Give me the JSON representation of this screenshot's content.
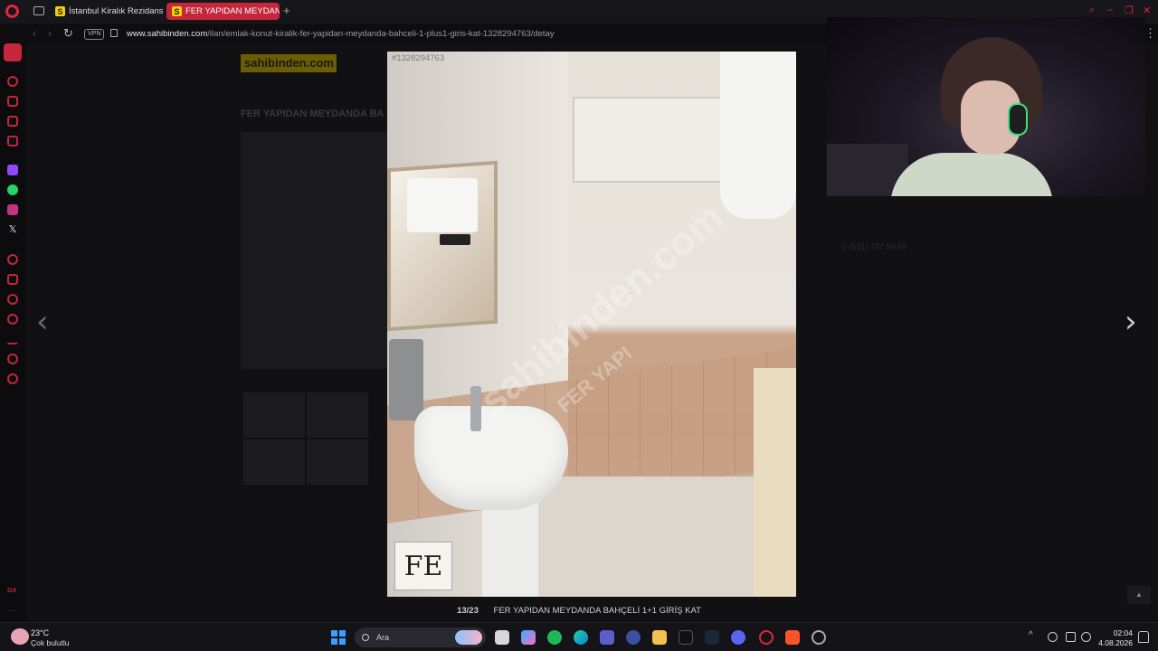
{
  "browser": {
    "tabs": [
      {
        "label": "İstanbul Kiralık Rezidans, V",
        "favicon": "S"
      },
      {
        "label": "FER YAPIDAN MEYDANDA",
        "favicon": "S",
        "active": true
      }
    ],
    "url_host": "www.sahibinden.com",
    "url_path": "/ilan/emlak-konut-kiralik-fer-yapidan-meydanda-bahceli-1-plus1-giris-kat-1328294763/detay",
    "vpn_label": "VPN",
    "accent_color": "#c5263b"
  },
  "page": {
    "logo_text": "sahibinden.com",
    "title_partial": "FER YAPIDAN MEYDANDA BA",
    "phone": "0 (531) 787 99 59"
  },
  "lightbox": {
    "listing_id": "#1328294763",
    "counter": "13/23",
    "caption": "FER YAPIDAN MEYDANDA BAHÇELİ 1+1 GİRİŞ KAT",
    "watermark": "sahibinden.com",
    "watermark2": "FER YAPI",
    "brand_mark": "FE",
    "prev_icon": "chevron-left-icon",
    "next_icon": "chevron-right-icon"
  },
  "taskbar": {
    "weather_temp": "23°C",
    "weather_desc": "Çok bulutlu",
    "search_placeholder": "Ara",
    "time": "02:04",
    "date": "4.08.2026"
  }
}
